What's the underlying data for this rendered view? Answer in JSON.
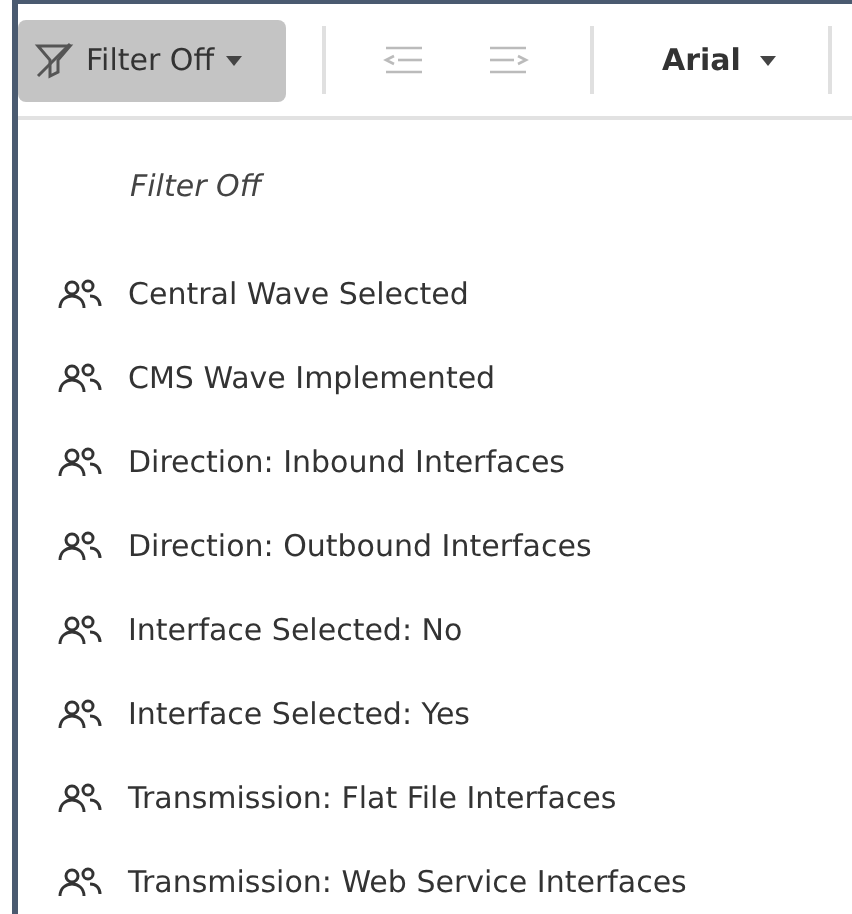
{
  "toolbar": {
    "filter_button": {
      "label": "Filter Off",
      "pressed": true
    },
    "indent_buttons": [
      {
        "kind": "outdent",
        "disabled": true
      },
      {
        "kind": "indent",
        "disabled": true
      }
    ],
    "font_select": {
      "value": "Arial"
    }
  },
  "menu": {
    "header": "Filter Off",
    "items": [
      {
        "label": "Central Wave Selected"
      },
      {
        "label": "CMS Wave Implemented"
      },
      {
        "label": "Direction: Inbound Interfaces"
      },
      {
        "label": "Direction: Outbound Interfaces"
      },
      {
        "label": "Interface Selected: No"
      },
      {
        "label": "Interface Selected: Yes"
      },
      {
        "label": "Transmission: Flat File Interfaces"
      },
      {
        "label": "Transmission: Web Service Interfaces"
      }
    ]
  }
}
